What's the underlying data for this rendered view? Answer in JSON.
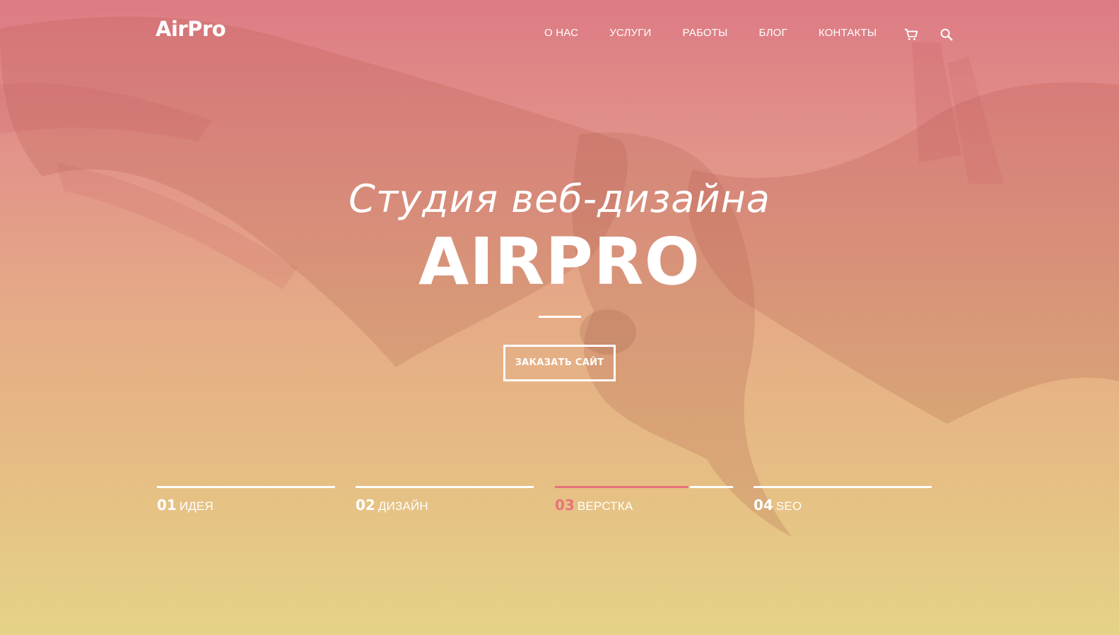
{
  "header": {
    "logo": "AirPro",
    "nav": [
      "О НАС",
      "УСЛУГИ",
      "РАБОТЫ",
      "БЛОГ",
      "КОНТАКТЫ"
    ],
    "icons": [
      "cart-icon",
      "search-icon"
    ]
  },
  "hero": {
    "subtitle": "Студия веб-дизайна",
    "title": "AIRPRO",
    "button_label": "ЗАКАЗАТЬ САЙТ",
    "background_image": "eagle with spread wings"
  },
  "steps": [
    {
      "number": "01",
      "label": "ИДЕЯ",
      "progress": 1.0,
      "active": false
    },
    {
      "number": "02",
      "label": "ДИЗАЙН",
      "progress": 1.0,
      "active": false
    },
    {
      "number": "03",
      "label": "ВЕРСТКА",
      "progress": 0.75,
      "active": true
    },
    {
      "number": "04",
      "label": "SEO",
      "progress": 1.0,
      "active": false
    }
  ],
  "colors": {
    "gradient_top": "#dd7b84",
    "gradient_bottom": "#e4d387",
    "accent": "#e9737c",
    "text": "#ffffff"
  }
}
